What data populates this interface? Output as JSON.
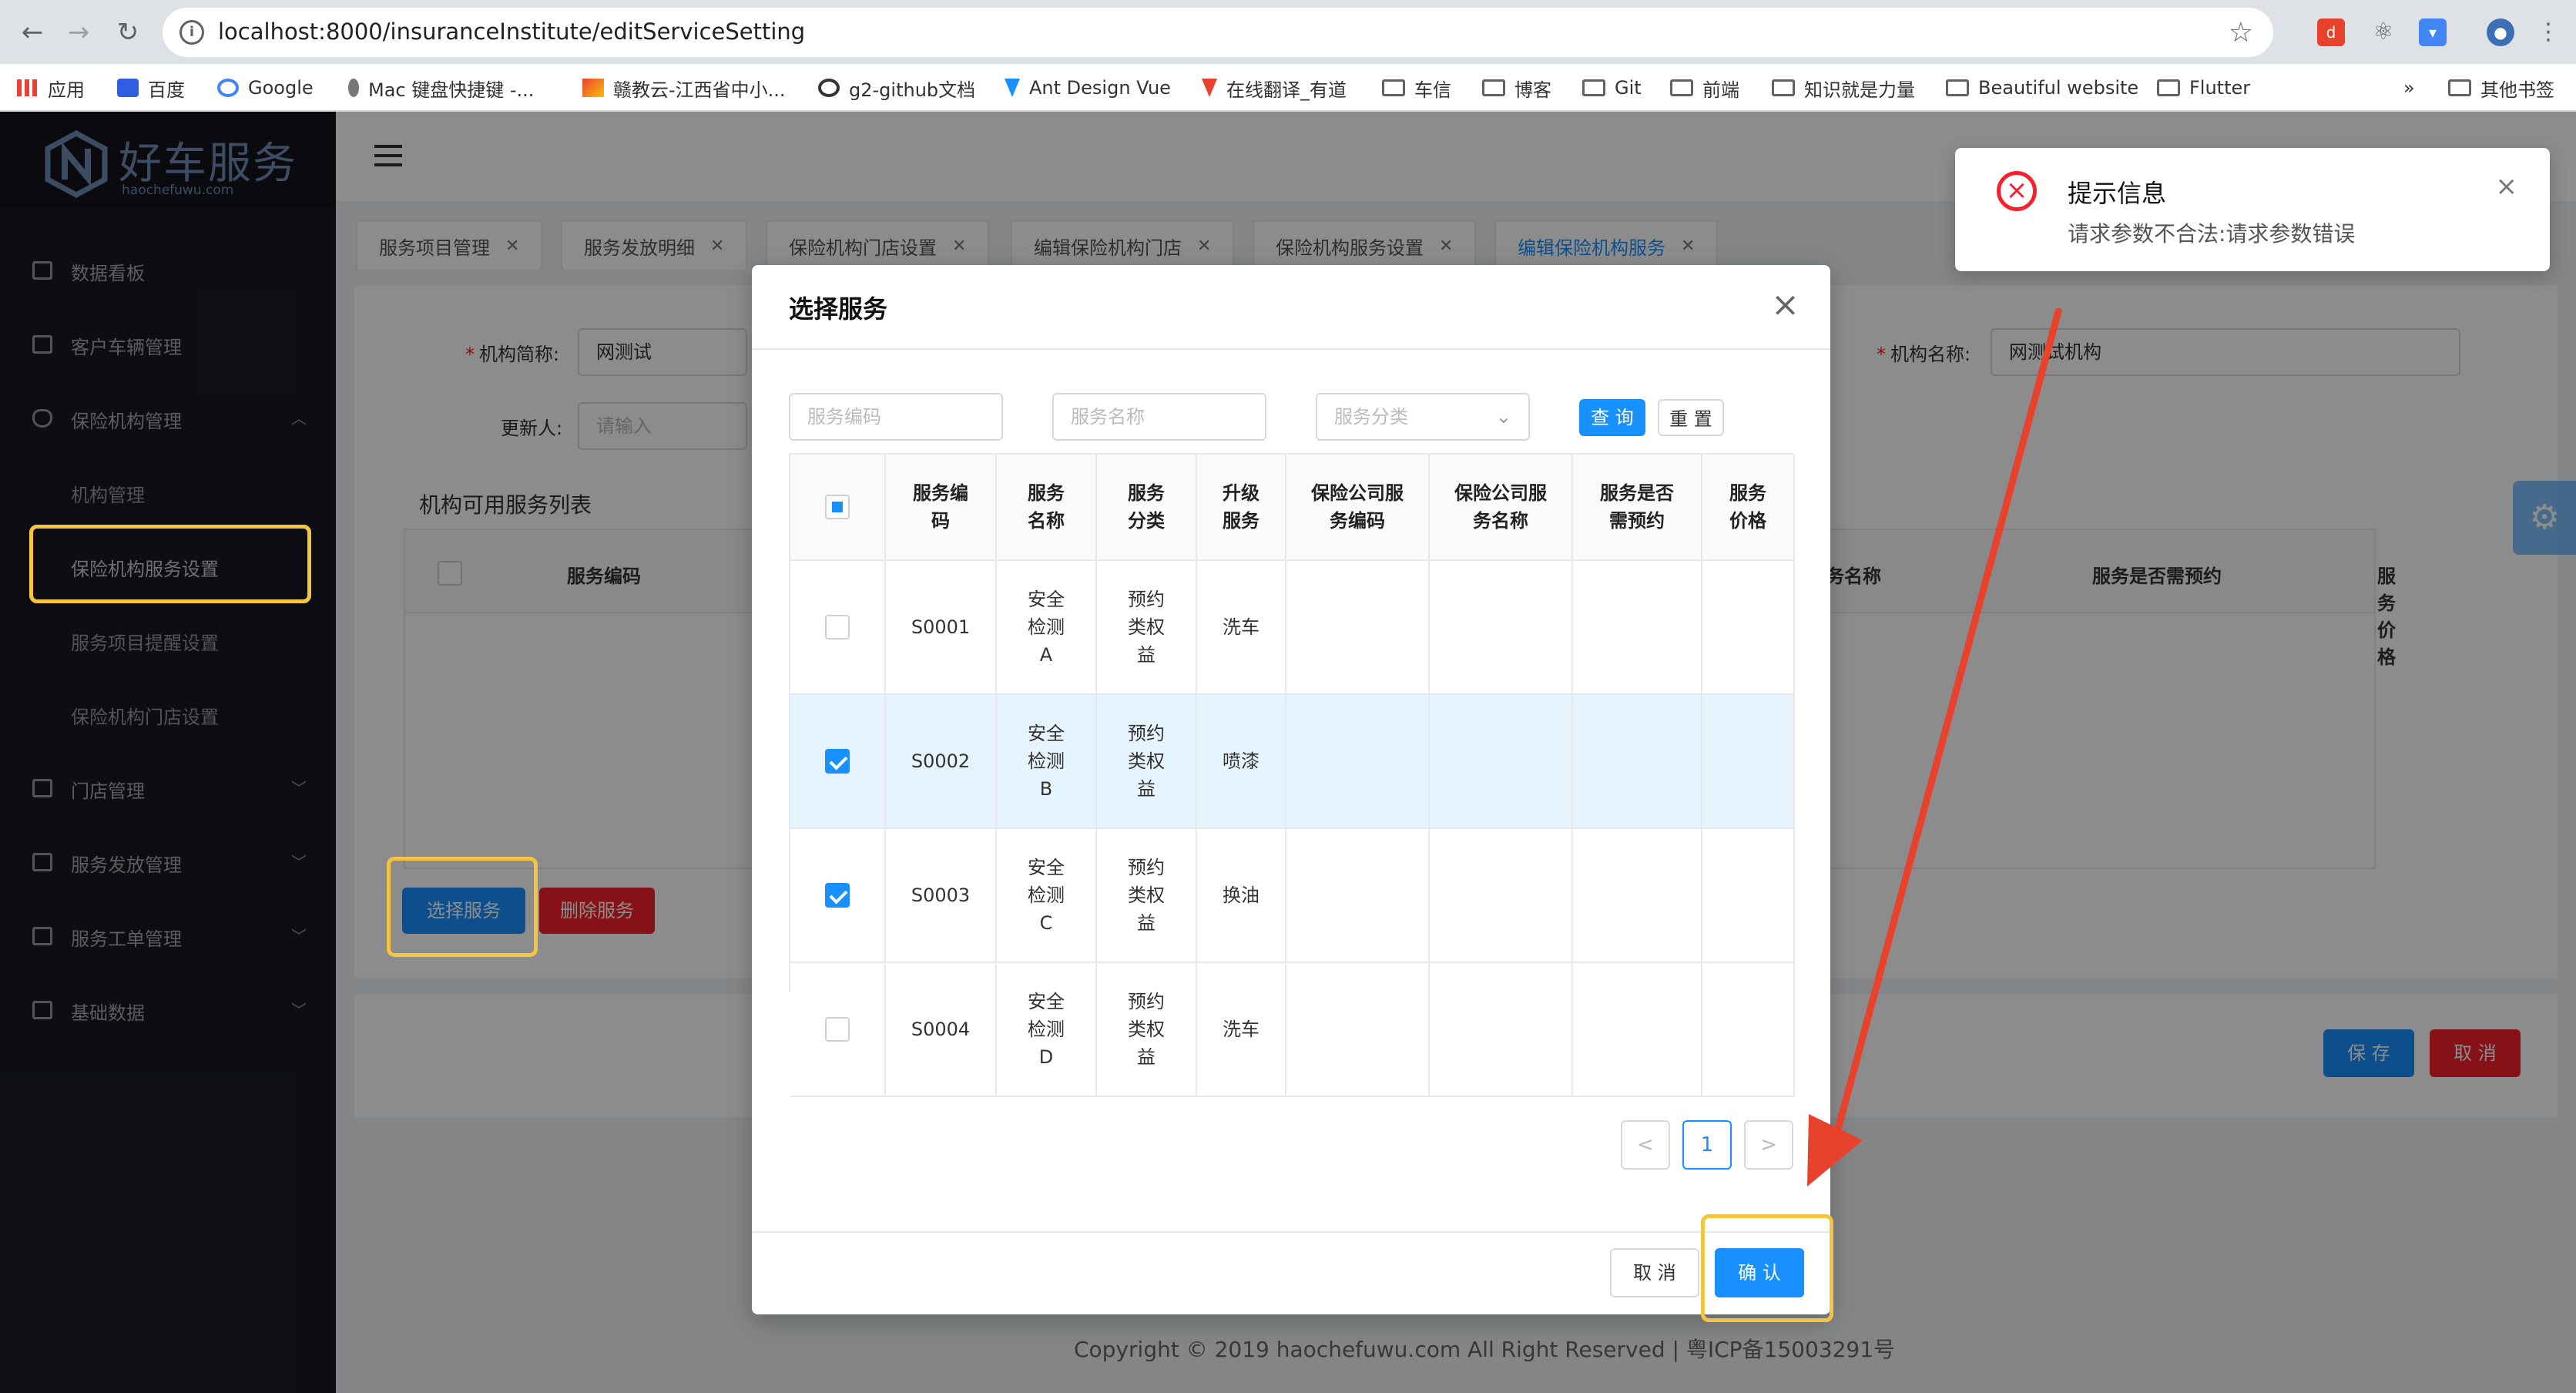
{
  "browser": {
    "url": "localhost:8000/insuranceInstitute/editServiceSetting",
    "bookmarks": [
      {
        "label": "应用"
      },
      {
        "label": "百度"
      },
      {
        "label": "Google"
      },
      {
        "label": "Mac 键盘快捷键 -..."
      },
      {
        "label": "赣教云-江西省中小..."
      },
      {
        "label": "g2-github文档"
      },
      {
        "label": "Ant Design Vue"
      },
      {
        "label": "在线翻译_有道"
      },
      {
        "label": "车信"
      },
      {
        "label": "博客"
      },
      {
        "label": "Git"
      },
      {
        "label": "前端"
      },
      {
        "label": "知识就是力量"
      },
      {
        "label": "Beautiful website"
      },
      {
        "label": "Flutter"
      }
    ],
    "more": "»",
    "other_bookmarks": "其他书签"
  },
  "sidebar": {
    "logo_title": "好车服务",
    "logo_sub": "haochefuwu.com",
    "items": [
      {
        "label": "数据看板"
      },
      {
        "label": "客户车辆管理"
      },
      {
        "label": "保险机构管理"
      },
      {
        "label": "门店管理"
      },
      {
        "label": "服务发放管理"
      },
      {
        "label": "服务工单管理"
      },
      {
        "label": "基础数据"
      }
    ],
    "subitems": [
      {
        "label": "机构管理"
      },
      {
        "label": "保险机构服务设置"
      },
      {
        "label": "服务项目提醒设置"
      },
      {
        "label": "保险机构门店设置"
      }
    ]
  },
  "tabs": [
    {
      "label": "服务项目管理"
    },
    {
      "label": "服务发放明细"
    },
    {
      "label": "保险机构门店设置"
    },
    {
      "label": "编辑保险机构门店"
    },
    {
      "label": "保险机构服务设置"
    },
    {
      "label": "编辑保险机构服务"
    }
  ],
  "form": {
    "short_name_label": "机构简称:",
    "short_name_value": "网测试",
    "full_name_label": "机构名称:",
    "full_name_value": "网测试机构",
    "updater_label": "更新人:",
    "updater_placeholder": "请输入",
    "list_title": "机构可用服务列表",
    "bg_cols": [
      "服务编码",
      "服务名称",
      "服务是否需预约",
      "服务价格"
    ],
    "select_btn": "选择服务",
    "delete_btn": "删除服务",
    "save_btn": "保 存",
    "cancel_btn": "取 消"
  },
  "footer": "Copyright © 2019 haochefuwu.com All Right Reserved | 粤ICP备15003291号",
  "modal": {
    "title": "选择服务",
    "filters": {
      "code_placeholder": "服务编码",
      "name_placeholder": "服务名称",
      "category_placeholder": "服务分类",
      "query_btn": "查 询",
      "reset_btn": "重 置"
    },
    "columns": [
      "服务编\n码",
      "服务\n名称",
      "服务\n分类",
      "升级\n服务",
      "保险公司服\n务编码",
      "保险公司服\n务名称",
      "服务是否\n需预约",
      "服务\n价格"
    ],
    "rows": [
      {
        "checked": false,
        "code": "S0001",
        "name": "安全\n检测\nA",
        "category": "预约\n类权\n益",
        "upgrade": "洗车",
        "ins_code": "",
        "ins_name": "",
        "booking": "",
        "price": ""
      },
      {
        "checked": true,
        "code": "S0002",
        "name": "安全\n检测\nB",
        "category": "预约\n类权\n益",
        "upgrade": "喷漆",
        "ins_code": "",
        "ins_name": "",
        "booking": "",
        "price": ""
      },
      {
        "checked": true,
        "code": "S0003",
        "name": "安全\n检测\nC",
        "category": "预约\n类权\n益",
        "upgrade": "换油",
        "ins_code": "",
        "ins_name": "",
        "booking": "",
        "price": ""
      },
      {
        "checked": false,
        "code": "S0004",
        "name": "安全\n检测\nD",
        "category": "预约\n类权\n益",
        "upgrade": "洗车",
        "ins_code": "",
        "ins_name": "",
        "booking": "",
        "price": ""
      }
    ],
    "pager": {
      "prev": "<",
      "current": "1",
      "next": ">"
    },
    "cancel_btn": "取 消",
    "confirm_btn": "确 认"
  },
  "toast": {
    "title": "提示信息",
    "message": "请求参数不合法:请求参数错误"
  },
  "colors": {
    "primary": "#1890ff",
    "danger": "#f5222d",
    "highlight": "#f5c542",
    "arrow": "#e8412c"
  },
  "icons": [
    "back-icon",
    "forward-icon",
    "reload-icon",
    "info-icon",
    "star-icon",
    "menu-fold-icon",
    "close-icon",
    "gear-icon",
    "error-icon",
    "chevron-down-icon"
  ]
}
